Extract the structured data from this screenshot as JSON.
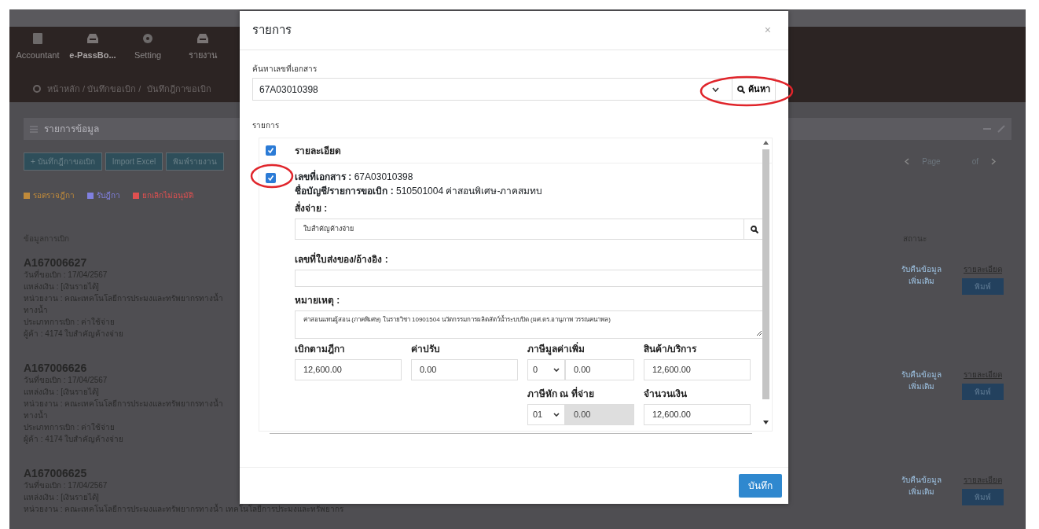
{
  "app": {
    "nav_items": [
      {
        "label": "Accountant"
      },
      {
        "label": "e-PassBo..."
      },
      {
        "label": "Setting"
      },
      {
        "label": "รายงาน"
      }
    ],
    "breadcrumb": [
      "หน้าหลัก / บันทึกขอเบิก /",
      "บันทึกฎีกาขอเบิก"
    ],
    "panel_title": "รายการข้อมูล",
    "toolbar_buttons": [
      "+ บันทึกฎีกาขอเบิก",
      "Import Excel",
      "พิมพ์รายงาน"
    ],
    "legend": [
      {
        "label": "รอตรวจฎีกา",
        "color": "#c08a3a"
      },
      {
        "label": "รับฎีกา",
        "color": "#8080e0"
      },
      {
        "label": "ยกเลิกไม่อนุมัติ",
        "color": "#e05050"
      }
    ],
    "pager": {
      "page": "Page",
      "of": "of"
    },
    "columns": [
      "ข้อมูลการเบิก",
      "สถานะ"
    ],
    "records": [
      {
        "code": "A167006627",
        "lines": [
          "วันที่ขอเบิก : 17/04/2567",
          "แหล่งเงิน : [เงินรายได้]",
          "หน่วยงาน : คณะเทคโนโลยีการประมงและทรัพยากรทางน้ำ",
          "ทางน้ำ",
          "ประเภทการเบิก : ค่าใช้จ่าย",
          "ผู้ค้า : 4174  ใบสำคัญค้างจ่าย"
        ],
        "status": "รับคืนข้อมูลเพิ่มเติม",
        "detail": "รายละเอียด",
        "print": "พิมพ์"
      },
      {
        "code": "A167006626",
        "lines": [
          "วันที่ขอเบิก : 17/04/2567",
          "แหล่งเงิน : [เงินรายได้]",
          "หน่วยงาน : คณะเทคโนโลยีการประมงและทรัพยากรทางน้ำ",
          "ทางน้ำ",
          "ประเภทการเบิก : ค่าใช้จ่าย",
          "ผู้ค้า : 4174  ใบสำคัญค้างจ่าย"
        ],
        "status": "รับคืนข้อมูลเพิ่มเติม",
        "detail": "รายละเอียด",
        "print": "พิมพ์"
      },
      {
        "code": "A167006625",
        "lines": [
          "วันที่ขอเบิก : 17/04/2567",
          "แหล่งเงิน : [เงินรายได้]",
          "หน่วยงาน : คณะเทคโนโลยีการประมงและทรัพยากรทางน้ำ เทคโนโลยีการประมงและทรัพยากร"
        ],
        "status": "รับคืนข้อมูลเพิ่มเติม",
        "detail": "รายละเอียด",
        "print": "พิมพ์"
      }
    ]
  },
  "modal": {
    "title": "รายการ",
    "close": "×",
    "search_label": "ค้นหาเลขที่เอกสาร",
    "search_value": "67A03010398",
    "search_button": "ค้นหา",
    "list_label": "รายการ",
    "header_row": {
      "label": "รายละเอียด",
      "checked": true
    },
    "item": {
      "checked": true,
      "doc": "**เลขที่เอกสาร :** 67A03010398",
      "account": "**ชื่อบัญชี/รายการขอเบิก :** 510501004 ค่าสอนพิเศษ-ภาคสมทบ",
      "pay_to": {
        "label": "สั่งจ่าย :",
        "value": "ใบสำคัญค้างจ่าย"
      },
      "reference": {
        "label": "เลขที่ใบส่งของ/อ้างอิง :"
      },
      "remark": {
        "label": "หมายเหตุ :",
        "value": "ค่าสอนแทนผู้สอน (ภาคพิเศษ) ในรายวิชา 10901504 นวัตกรรมการผลิตสัตว์น้ำระบบปิด (ผศ.ดร.อานุภาพ วรรณคนาพล)"
      },
      "amounts": [
        {
          "kind": "input",
          "label": "เบิกตามฎีกา",
          "value": "12,600.00"
        },
        {
          "kind": "input",
          "label": "ค่าปรับ",
          "value": "0.00"
        },
        {
          "kind": "tax",
          "label": "ภาษีมูลค่าเพิ่ม",
          "rate": "0",
          "value": "0.00",
          "disabled": false
        },
        {
          "kind": "input",
          "label": "สินค้า/บริการ",
          "value": "12,600.00"
        },
        {
          "kind": "blank"
        },
        {
          "kind": "blank"
        },
        {
          "kind": "tax",
          "label": "ภาษีหัก ณ ที่จ่าย",
          "rate": "01",
          "value": "0.00",
          "disabled": true
        },
        {
          "kind": "input",
          "label": "จำนวนเงิน",
          "value": "12,600.00"
        }
      ]
    },
    "save_button": "บันทึก"
  }
}
